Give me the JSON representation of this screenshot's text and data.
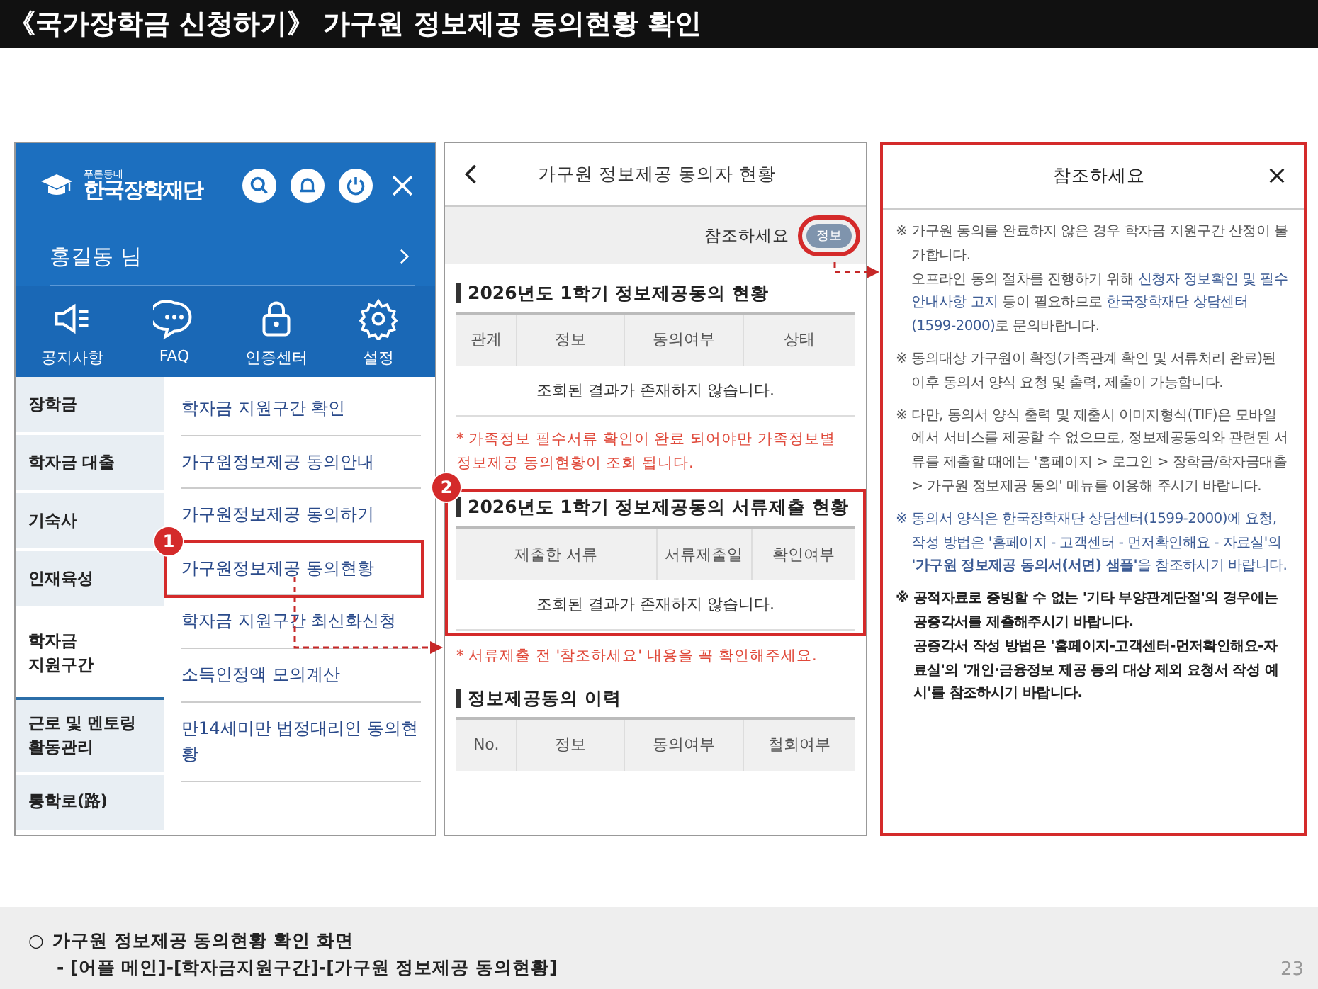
{
  "title": "《국가장학금 신청하기》 가구원 정보제공 동의현황 확인",
  "menu_screen": {
    "logo_caption": "푸른등대",
    "logo": "한국장학재단",
    "user": "홍길동 님",
    "quick_menu": [
      {
        "label": "공지사항",
        "kind": "megaphone"
      },
      {
        "label": "FAQ",
        "kind": "chat"
      },
      {
        "label": "인증센터",
        "kind": "lock"
      },
      {
        "label": "설정",
        "kind": "gear"
      }
    ],
    "categories": [
      {
        "label": "장학금",
        "selected": false
      },
      {
        "label": "학자금 대출",
        "selected": false
      },
      {
        "label": "기숙사",
        "selected": false
      },
      {
        "label": "인재육성",
        "selected": false
      },
      {
        "label": "학자금\n지원구간",
        "selected": true
      },
      {
        "label": "근로 및 멘토링\n활동관리",
        "selected": false
      },
      {
        "label": "통학로(路)",
        "selected": false
      }
    ],
    "submenu": [
      {
        "label": "학자금 지원구간 확인",
        "highlighted": false
      },
      {
        "label": "가구원정보제공 동의안내",
        "highlighted": false
      },
      {
        "label": "가구원정보제공 동의하기",
        "highlighted": false
      },
      {
        "label": "가구원정보제공 동의현황",
        "highlighted": true,
        "callout": "1"
      },
      {
        "label": "학자금 지원구간 최신화신청",
        "highlighted": false
      },
      {
        "label": "소득인정액 모의계산",
        "highlighted": false
      },
      {
        "label": "만14세미만 법정대리인 동의현황",
        "highlighted": false
      }
    ]
  },
  "status_screen": {
    "title": "가구원 정보제공 동의자 현황",
    "ref_label": "참조하세요",
    "info_badge": "정보",
    "info_highlighted": true,
    "sections": [
      {
        "heading": "2026년도 1학기 정보제공동의 현황",
        "columns": [
          "관계",
          "정보",
          "동의여부",
          "상태"
        ],
        "empty_message": "조회된 결과가 존재하지 않습니다.",
        "note": "* 가족정보 필수서류 확인이 완료 되어야만 가족정보별 정보제공 동의현황이 조회 됩니다.",
        "highlighted": false
      },
      {
        "heading": "2026년도 1학기 정보제공동의 서류제출 현황",
        "columns": [
          "제출한 서류",
          "서류제출일",
          "확인여부"
        ],
        "empty_message": "조회된 결과가 존재하지 않습니다.",
        "note": "* 서류제출 전 '참조하세요' 내용을 꼭 확인해주세요.",
        "highlighted": true,
        "callout": "2"
      },
      {
        "heading": "정보제공동의 이력",
        "columns": [
          "No.",
          "정보",
          "동의여부",
          "철회여부"
        ],
        "highlighted": false
      }
    ]
  },
  "ref_panel": {
    "title": "참조하세요",
    "highlighted": true,
    "notes": [
      {
        "mark": "※",
        "kind": "plain",
        "segments": [
          {
            "kind": "text",
            "text": "가구원 동의를 완료하지 않은 경우 학자금 지원구간 산정이 불가합니다.\n오프라인 동의 절차를 진행하기 위해 "
          },
          {
            "kind": "link",
            "text": "신청자 정보확인 및 필수안내사항 고지"
          },
          {
            "kind": "text",
            "text": " 등이 필요하므로 "
          },
          {
            "kind": "link",
            "text": "한국장학재단 상담센터(1599-2000)"
          },
          {
            "kind": "text",
            "text": "로 문의바랍니다."
          }
        ]
      },
      {
        "mark": "※",
        "kind": "plain",
        "segments": [
          {
            "kind": "text",
            "text": "동의대상 가구원이 확정(가족관계 확인 및 서류처리 완료)된 이후 동의서 양식 요청 및 출력, 제출이 가능합니다."
          }
        ]
      },
      {
        "mark": "※",
        "kind": "plain",
        "segments": [
          {
            "kind": "text",
            "text": "다만, 동의서 양식 출력 및 제출시 이미지형식(TIF)은 모바일에서 서비스를 제공할 수 없으므로, 정보제공동의와 관련된 서류를 제출할 때에는 '홈페이지 > 로그인 > 장학금/학자금대출 > 가구원 정보제공 동의' 메뉴를 이용해 주시기 바랍니다."
          }
        ]
      },
      {
        "mark": "※",
        "kind": "blue",
        "segments": [
          {
            "kind": "text",
            "text": "동의서 양식은 한국장학재단 상담센터(1599-2000)에 요청, 작성 방법은 '홈페이지 - 고객센터 - 먼저확인해요 - 자료실'의 "
          },
          {
            "kind": "strong",
            "text": "'가구원 정보제공 동의서(서면) 샘플'"
          },
          {
            "kind": "text",
            "text": "을 참조하시기 바랍니다."
          }
        ]
      },
      {
        "mark": "※",
        "kind": "bold",
        "segments": [
          {
            "kind": "text",
            "text": "공적자료로 증빙할 수 없는 '기타 부양관계단절'의 경우에는 공증각서를 제출해주시기 바랍니다.\n공증각서 작성 방법은 '홈페이지-고객센터-먼저확인해요-자료실'의 '개인·금융정보 제공 동의 대상 제외 요청서 작성 예시'를 참조하시기 바랍니다."
          }
        ]
      }
    ]
  },
  "footer": {
    "bullet": "○",
    "heading": "가구원 정보제공 동의현황 확인 화면",
    "path": "- [어플 메인]-[학자금지원구간]-[가구원 정보제공 동의현황]",
    "page": "23"
  }
}
